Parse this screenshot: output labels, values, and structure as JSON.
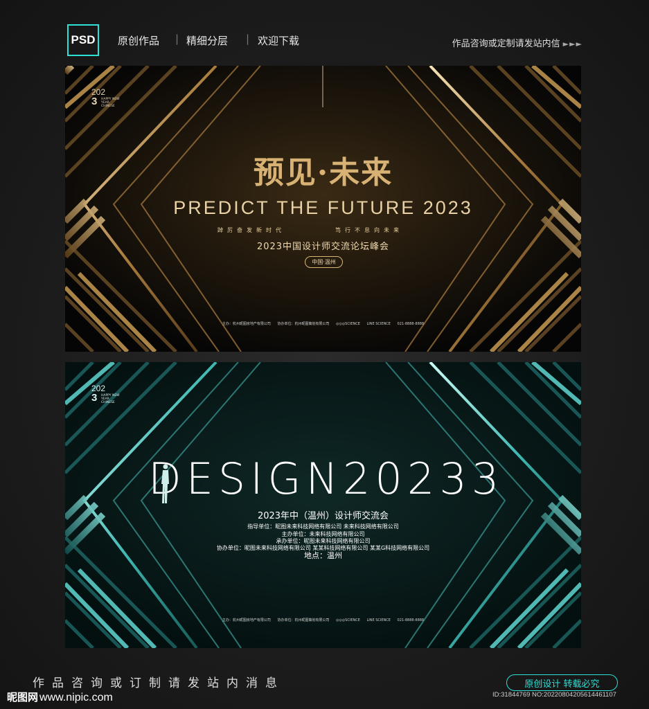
{
  "header": {
    "badge": "PSD",
    "items": [
      "原创作品",
      "精细分层",
      "欢迎下载"
    ],
    "separator": "|",
    "contact": "作品咨询或定制请发站内信",
    "arrows": "►►►"
  },
  "banner_gold": {
    "year_top": "202",
    "year_bottom": "3",
    "year_small": "HAPPY NEW YEAR CHINESE",
    "title": "预见·未来",
    "subtitle_en": "PREDICT THE FUTURE 2023",
    "slogan_left": "踔厉奋发新时代",
    "slogan_right": "笃行不怠向未来",
    "event": "2023中国设计师交流论坛峰会",
    "location": "中国·温州",
    "footer": [
      "主办：杭州昵图房地产有限公司",
      "协办单位：杭州昵图策划有限公司",
      "◎◎◎SCIENCE",
      "LINE SCIENCE",
      "021-8888-8888"
    ]
  },
  "banner_teal": {
    "year_top": "202",
    "year_bottom": "3",
    "year_small": "HAPPY NEW YEAR CHINESE",
    "title": "DESIGN20233",
    "event": "2023年中（温州）设计师交流会",
    "guide": "指导单位：昵图未来科技网络有限公司  未来科技网络有限公司",
    "host": "主办单位：未来科技网络有限公司",
    "organizer": "承办单位：昵图未来科技网络有限公司",
    "co_organizer": "协办单位：昵图未来科技网络有限公司 某某科技网络有限公司 某某G科技网络有限公司",
    "venue": "地点：温州",
    "footer": [
      "主办：杭州昵图房地产有限公司",
      "协办单位：杭州昵图策划有限公司",
      "◎◎◎SCIENCE",
      "LINE SCIENCE",
      "021-8888-8888"
    ]
  },
  "bottom": {
    "slogan": "作品咨询或订制请发站内消息",
    "site_cn": "昵图网",
    "site_url": "www.nipic.com",
    "badge": "原创设计  转载必究",
    "id": "ID:31844769 NO:20220804205614461107"
  },
  "colors": {
    "accent": "#2ee0d6",
    "gold": "#d8b275",
    "teal": "#5fd6d0"
  }
}
